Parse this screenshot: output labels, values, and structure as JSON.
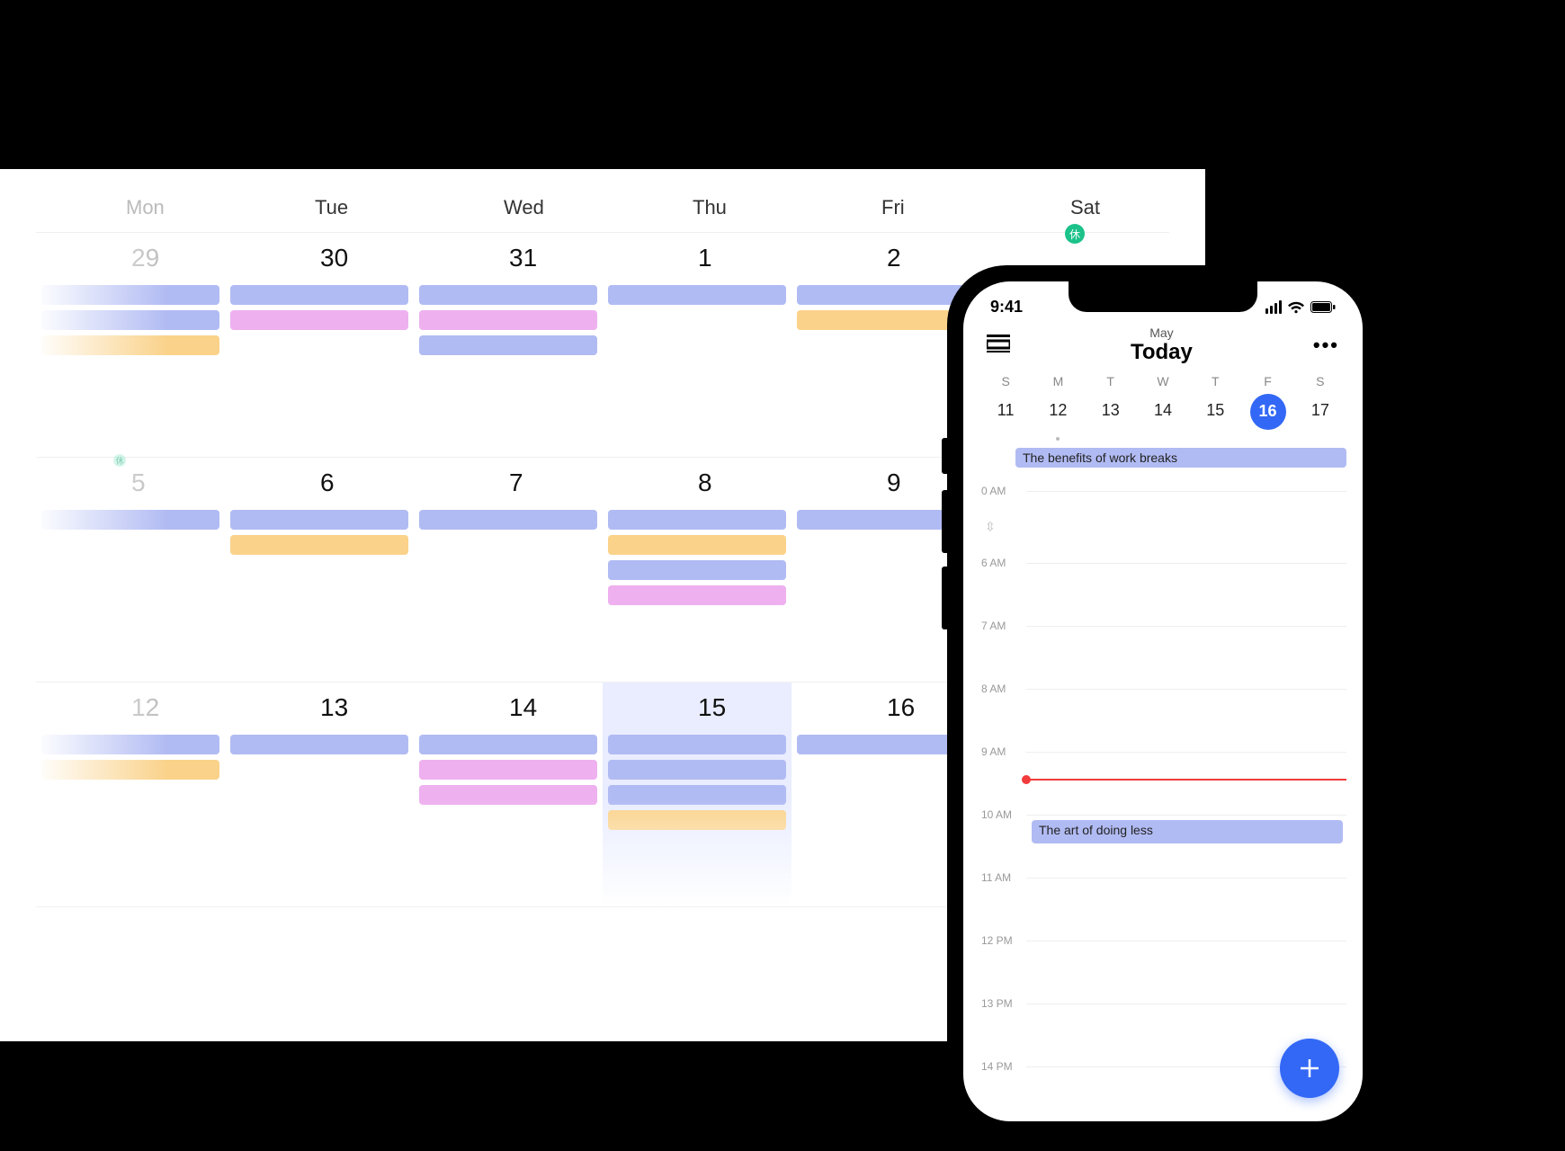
{
  "desktop": {
    "day_labels": [
      "Mon",
      "Tue",
      "Wed",
      "Thu",
      "Fri",
      "Sat"
    ],
    "holiday_badge": "休",
    "small_badge": "休",
    "weeks": [
      {
        "days": [
          {
            "num": "29",
            "gray": true,
            "events": [
              "blue",
              "blue",
              "yellow"
            ],
            "fade_left": true
          },
          {
            "num": "30",
            "events": [
              "blue",
              "pink"
            ]
          },
          {
            "num": "31",
            "events": [
              "blue",
              "pink",
              "blue"
            ]
          },
          {
            "num": "1",
            "events": [
              "blue"
            ]
          },
          {
            "num": "2",
            "events": [
              "blue",
              "yellow"
            ]
          },
          {
            "num": "",
            "events": [],
            "holiday": true
          }
        ]
      },
      {
        "days": [
          {
            "num": "5",
            "gray": true,
            "events": [
              "blue"
            ],
            "fade_left": true,
            "small_badge": true
          },
          {
            "num": "6",
            "events": [
              "blue",
              "yellow"
            ]
          },
          {
            "num": "7",
            "events": [
              "blue"
            ]
          },
          {
            "num": "8",
            "events": [
              "blue",
              "yellow",
              "blue",
              "pink"
            ]
          },
          {
            "num": "9",
            "events": [
              "blue"
            ]
          },
          {
            "num": "",
            "events": []
          }
        ]
      },
      {
        "days": [
          {
            "num": "12",
            "gray": true,
            "events": [
              "blue",
              "yellow"
            ],
            "fade_left": true
          },
          {
            "num": "13",
            "events": [
              "blue"
            ]
          },
          {
            "num": "14",
            "events": [
              "blue",
              "pink",
              "pink"
            ]
          },
          {
            "num": "15",
            "events": [
              "blue",
              "blue",
              "blue",
              "yellow"
            ],
            "selected": true
          },
          {
            "num": "16",
            "events": [
              "blue"
            ]
          },
          {
            "num": "",
            "events": []
          }
        ]
      }
    ]
  },
  "phone": {
    "status_time": "9:41",
    "month_label": "May",
    "title": "Today",
    "week_day_labels": [
      "S",
      "M",
      "T",
      "W",
      "T",
      "F",
      "S"
    ],
    "week_day_nums": [
      "11",
      "12",
      "13",
      "14",
      "15",
      "16",
      "17"
    ],
    "selected_index": 5,
    "dot_index": 1,
    "allday_event": "The benefits of work breaks",
    "hours": [
      "0 AM",
      "6 AM",
      "7 AM",
      "8 AM",
      "9 AM",
      "10 AM",
      "11 AM",
      "12 PM",
      "13 PM",
      "14 PM"
    ],
    "timed_event": "The art of doing less"
  }
}
